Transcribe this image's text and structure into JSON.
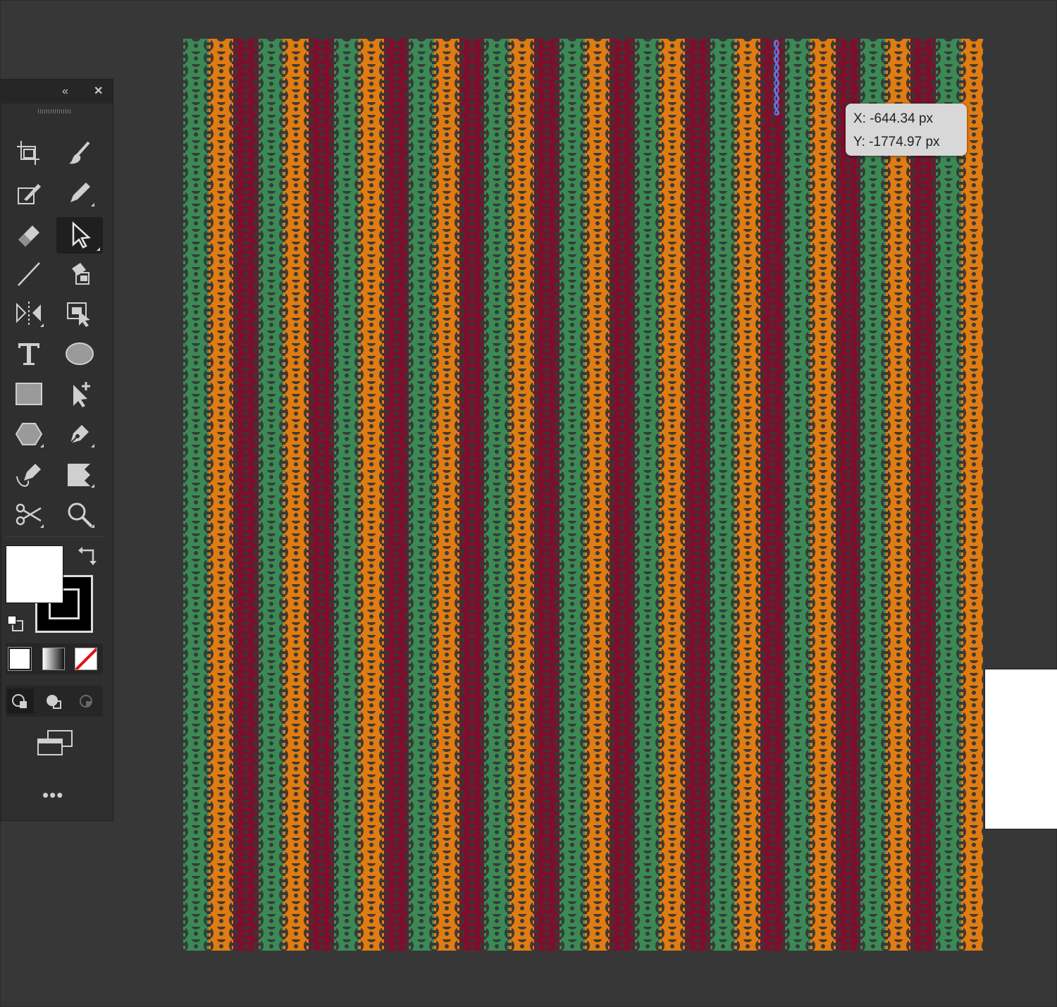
{
  "tooltip": {
    "x_line": "X: -644.34 px",
    "y_line": "Y: -1774.97 px"
  },
  "colors": {
    "canvas_bg": "#373737",
    "stripe_green": "#3b8a55",
    "stripe_orange": "#e07c12",
    "stripe_red": "#7d0f2c",
    "selection_blue": "#5b7be0",
    "fill": "#ffffff",
    "stroke": "#000000"
  },
  "pattern": {
    "stripe_sequence": [
      "green",
      "orange",
      "red",
      "green",
      "orange",
      "red",
      "green",
      "orange",
      "red",
      "green",
      "orange",
      "red",
      "green",
      "orange",
      "red",
      "green",
      "orange",
      "red",
      "green",
      "orange",
      "red",
      "green",
      "orange",
      "red",
      "green",
      "orange",
      "red",
      "green",
      "orange",
      "red",
      "green",
      "orange"
    ]
  },
  "tools_panel": {
    "collapse_icon": "double-chevron-left-icon",
    "close_icon": "close-icon",
    "more_label": "•••",
    "tools": [
      {
        "name": "artboard-tool",
        "icon": "artboard-icon"
      },
      {
        "name": "paintbrush-tool",
        "icon": "paintbrush-icon"
      },
      {
        "name": "shaper-tool",
        "icon": "shaper-icon"
      },
      {
        "name": "pencil-tool",
        "icon": "pencil-icon"
      },
      {
        "name": "eraser-tool",
        "icon": "eraser-icon"
      },
      {
        "name": "direct-selection-tool",
        "icon": "direct-selection-arrow-icon",
        "active": true
      },
      {
        "name": "line-segment-tool",
        "icon": "line-segment-icon"
      },
      {
        "name": "live-paint-tool",
        "icon": "live-paint-bucket-icon"
      },
      {
        "name": "reflect-tool",
        "icon": "reflect-icon"
      },
      {
        "name": "free-transform-tool",
        "icon": "free-transform-icon"
      },
      {
        "name": "type-tool",
        "icon": "type-icon"
      },
      {
        "name": "ellipse-tool",
        "icon": "ellipse-icon"
      },
      {
        "name": "rectangle-tool",
        "icon": "rectangle-icon"
      },
      {
        "name": "add-anchor-point-tool",
        "icon": "add-anchor-point-icon"
      },
      {
        "name": "polygon-tool",
        "icon": "polygon-icon"
      },
      {
        "name": "pen-tool",
        "icon": "pen-icon"
      },
      {
        "name": "curvature-tool",
        "icon": "curvature-icon"
      },
      {
        "name": "shape-builder-tool",
        "icon": "shape-builder-icon"
      },
      {
        "name": "scissors-tool",
        "icon": "scissors-icon"
      },
      {
        "name": "zoom-tool",
        "icon": "zoom-icon"
      }
    ]
  }
}
